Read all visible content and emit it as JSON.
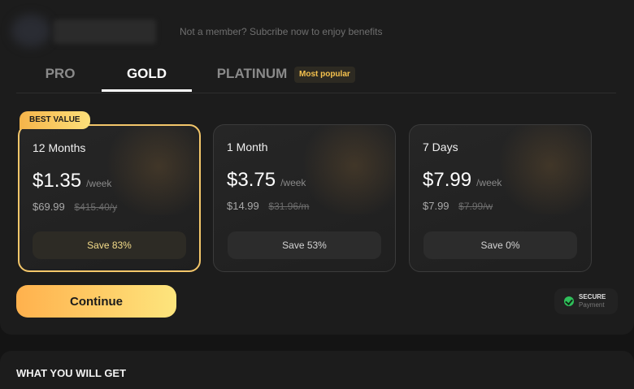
{
  "header": {
    "member_text": "Not a member? Subcribe now to enjoy benefits"
  },
  "tabs": [
    {
      "label": "PRO",
      "active": false
    },
    {
      "label": "GOLD",
      "active": true
    },
    {
      "label": "PLATINUM",
      "active": false
    }
  ],
  "platinum_badge": "Most popular",
  "best_value_badge": "BEST VALUE",
  "plans": [
    {
      "name": "12 Months",
      "price": "$1.35",
      "unit": "/week",
      "total": "$69.99",
      "original": "$415.40/y",
      "save": "Save 83%",
      "selected": true
    },
    {
      "name": "1 Month",
      "price": "$3.75",
      "unit": "/week",
      "total": "$14.99",
      "original": "$31.96/m",
      "save": "Save 53%",
      "selected": false
    },
    {
      "name": "7 Days",
      "price": "$7.99",
      "unit": "/week",
      "total": "$7.99",
      "original": "$7.99/w",
      "save": "Save 0%",
      "selected": false
    }
  ],
  "continue_label": "Continue",
  "secure": {
    "line1": "SECURE",
    "line2": "Payment",
    "icon": "shield-check-icon"
  },
  "benefits_title": "WHAT YOU WILL GET",
  "colors": {
    "accent_start": "#ffb14d",
    "accent_end": "#fde57d",
    "selected_border": "#f3c66a",
    "secure_green": "#2fbf5a"
  }
}
